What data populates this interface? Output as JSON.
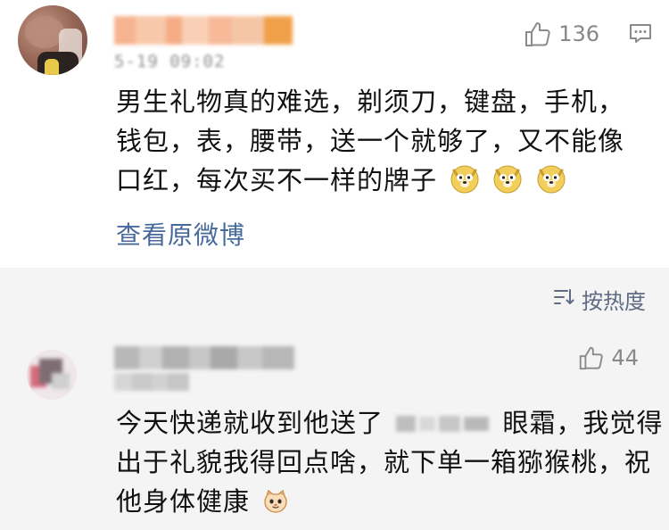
{
  "main_comment": {
    "like_count": "136",
    "text_lines": [
      "男生礼物真的难选，剃须刀，键盘，手机，",
      "钱包，表，腰带，送一个就够了，又不能像",
      "口红，每次买不一样的牌子"
    ],
    "view_original_label": "查看原微博"
  },
  "sort": {
    "label": "按热度"
  },
  "reply": {
    "like_count": "44",
    "text_lines": [
      "今天快递就收到他送了",
      "眼霜，我觉得",
      "出于礼貌我得回点啥，就下单一箱猕猴桃，祝",
      "他身体健康"
    ]
  },
  "icons": {
    "like": "thumbs-up-icon",
    "comment": "comment-icon",
    "sort": "sort-icon",
    "doge": "doge-emoji-icon",
    "cat": "cat-emoji-icon"
  },
  "colors": {
    "link": "#476a9b",
    "sort_text": "#5f6b82",
    "meta_gray": "#8f8f8f",
    "background": "#f4f4f4"
  }
}
